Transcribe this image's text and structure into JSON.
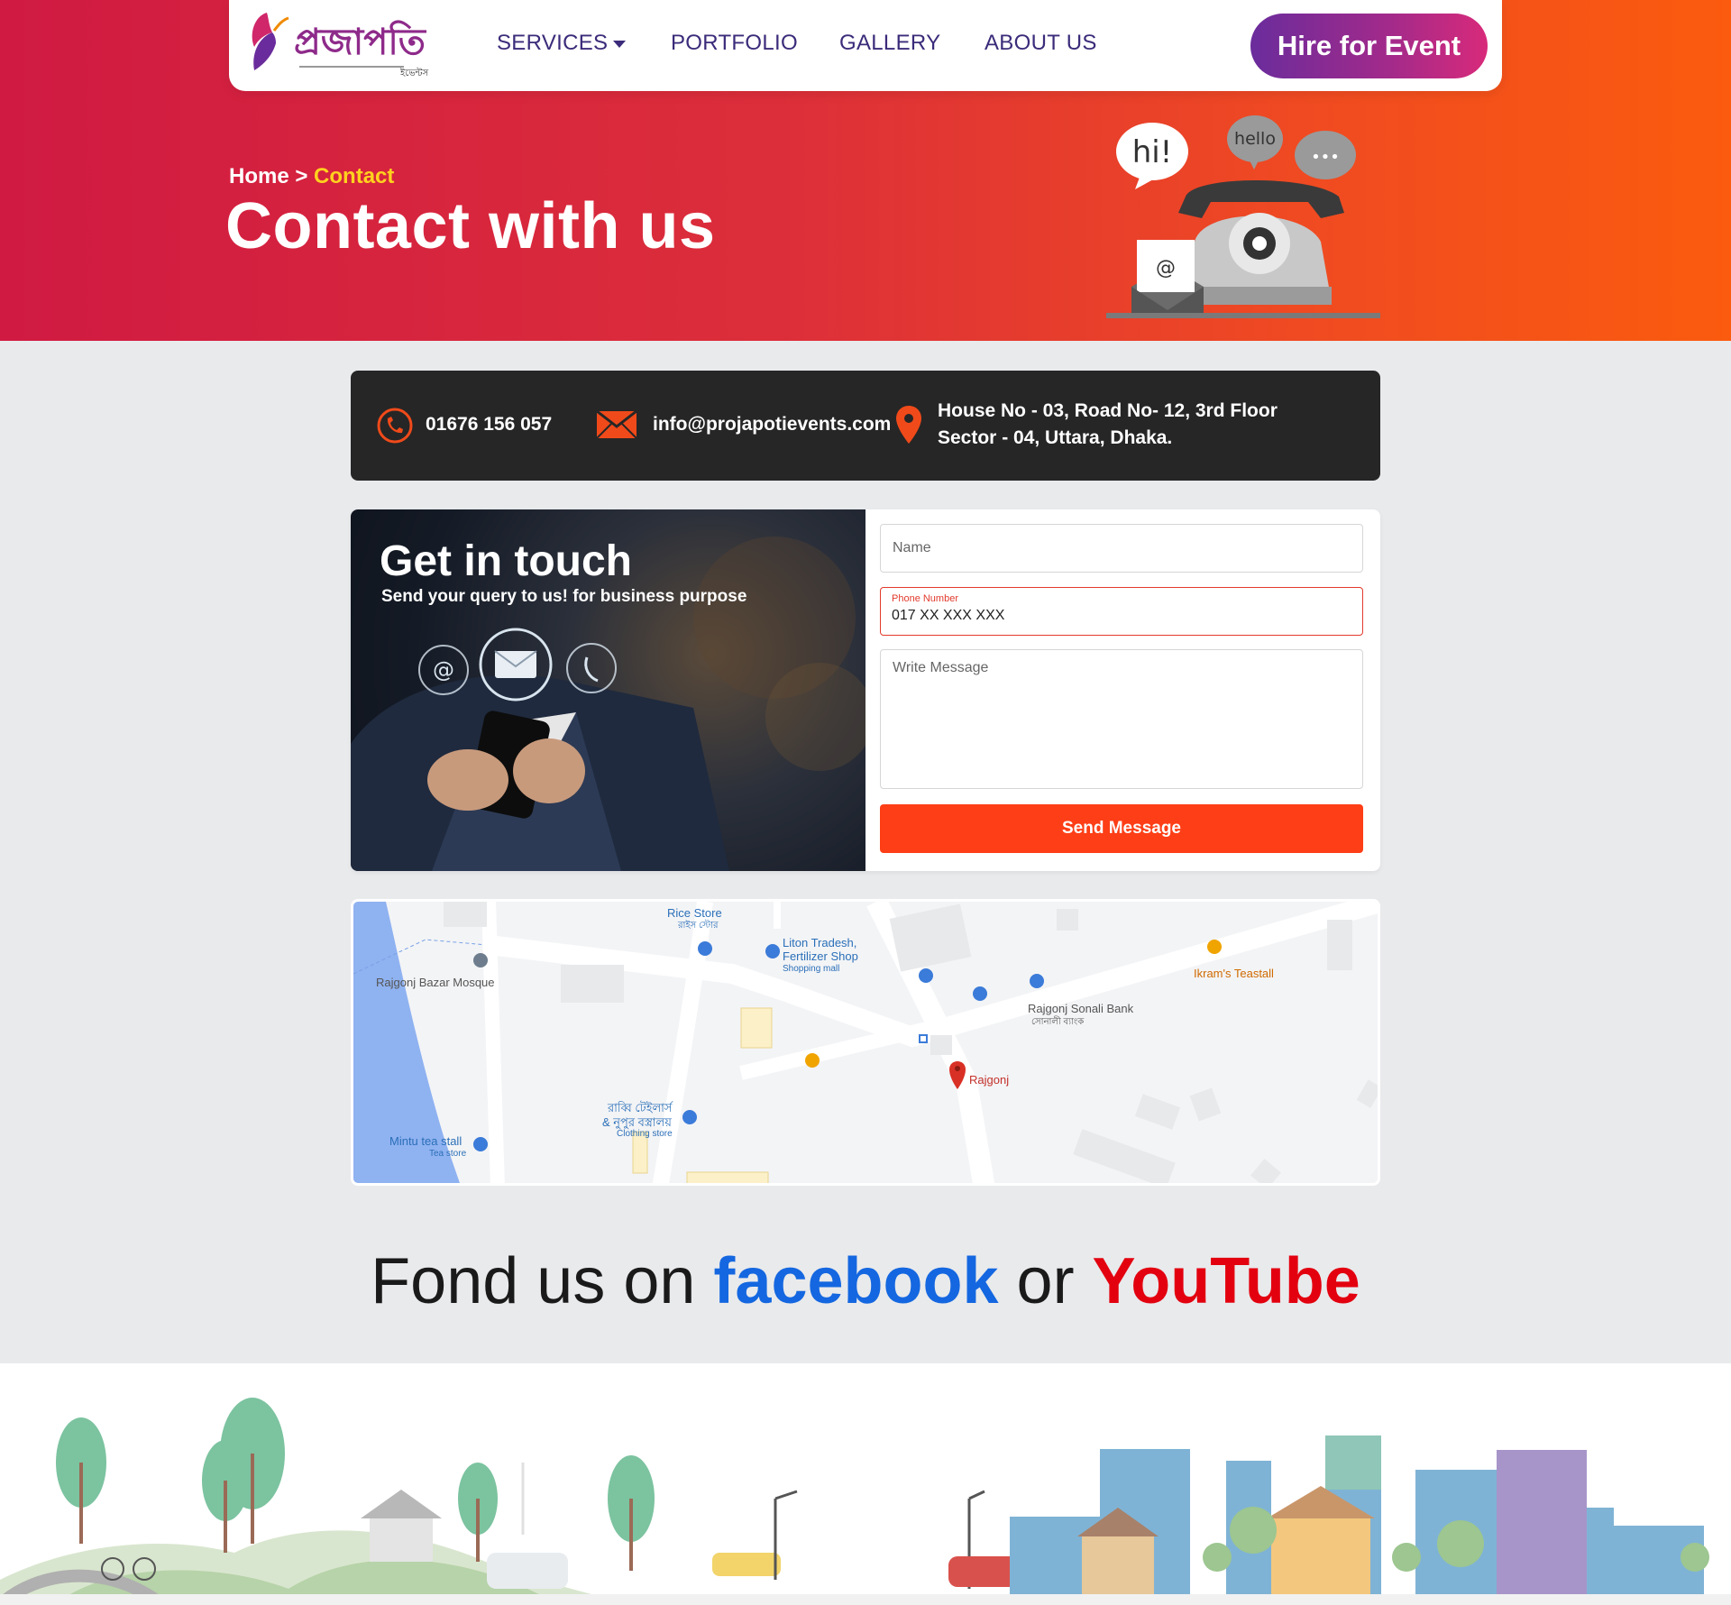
{
  "nav": {
    "logo_text": "প্রজাপতি",
    "logo_sub": "ইভেন্টস",
    "items": [
      {
        "label": "SERVICES"
      },
      {
        "label": "PORTFOLIO"
      },
      {
        "label": "GALLERY"
      },
      {
        "label": "ABOUT US"
      }
    ],
    "hire_label": "Hire for Event"
  },
  "hero": {
    "breadcrumb_home": "Home",
    "breadcrumb_sep": " > ",
    "breadcrumb_current": "Contact",
    "title": "Contact with us",
    "bubbles": [
      "hi!",
      "hello",
      "•••"
    ],
    "mail_symbol": "@"
  },
  "contact": {
    "phone": "01676 156 057",
    "email": "info@projapotievents.com",
    "address_line1": "House No - 03, Road No- 12, 3rd Floor",
    "address_line2": "Sector - 04, Uttara, Dhaka."
  },
  "form": {
    "heading": "Get in touch",
    "subheading": "Send your query to us! for business purpose",
    "name_placeholder": "Name",
    "phone_label": "Phone Number",
    "phone_value": "017 XX XXX XXX",
    "message_placeholder": "Write Message",
    "send_label": "Send Message"
  },
  "map": {
    "labels": {
      "rice_store": "Rice Store",
      "rice_store_bn": "রাইস স্টোর",
      "liton": "Liton Tradesh,",
      "liton2": "Fertilizer Shop",
      "liton_type": "Shopping mall",
      "mosque": "Rajgonj Bazar Mosque",
      "bank": "Rajgonj Sonali Bank",
      "bank_bn": "সোনালী ব্যাংক",
      "teastall": "Ikram's Teastall",
      "rajgonj": "Rajgonj",
      "tailor1": "রাব্বি টেইলার্স",
      "tailor2": "& নুপুর বস্ত্রালয়",
      "tailor_type": "Clothing store",
      "mintu": "Mintu tea stall",
      "mintu_type": "Tea store"
    }
  },
  "social": {
    "prefix": "Fond us on ",
    "facebook": "facebook",
    "or": " or ",
    "youtube": "YouTube"
  },
  "colors": {
    "hero_start": "#d01a42",
    "hero_end": "#fb5b0e",
    "nav_text": "#3b2b7a",
    "accent_yellow": "#ffd21e",
    "send_button": "#fd3e16",
    "facebook": "#1467e0",
    "youtube": "#e3000f"
  }
}
